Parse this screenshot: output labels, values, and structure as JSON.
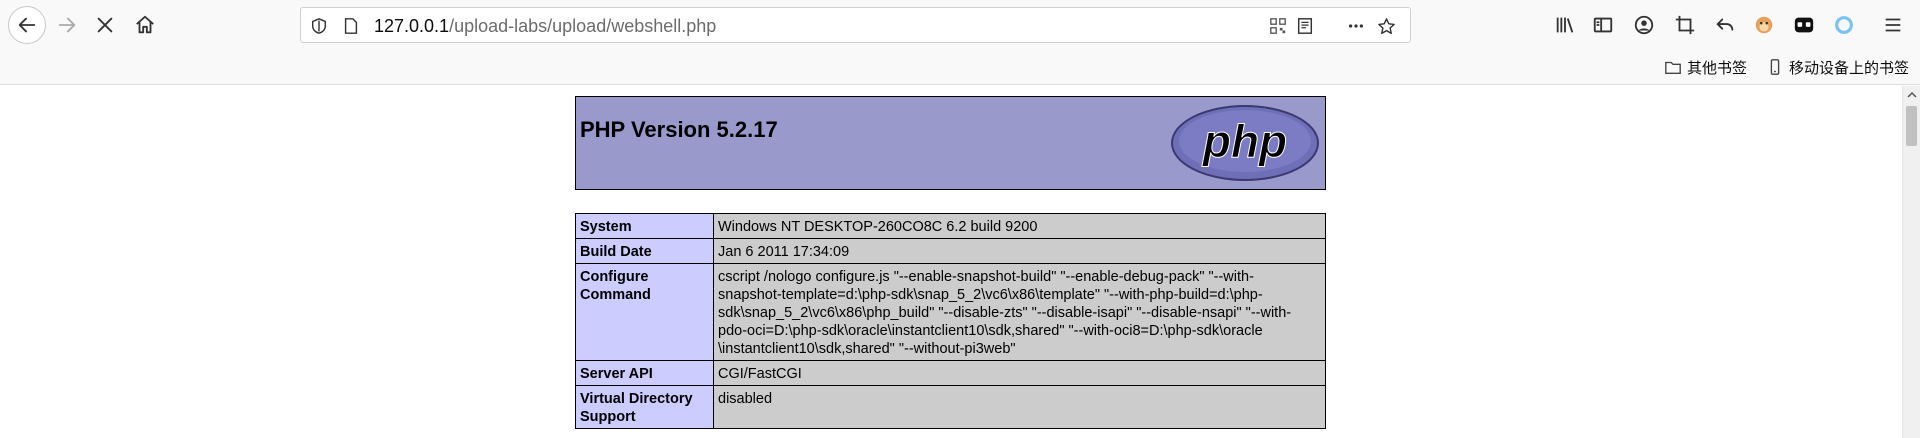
{
  "browser": {
    "url_host": "127.0.0.1",
    "url_path": "/upload-labs/upload/webshell.php",
    "bookmarks": [
      {
        "label": "其他书签",
        "icon": "folder-icon"
      },
      {
        "label": "移动设备上的书签",
        "icon": "mobile-device-icon"
      }
    ]
  },
  "php": {
    "version_title": "PHP Version 5.2.17",
    "logo_text": "php",
    "rows": [
      {
        "key": "System",
        "value": "Windows NT DESKTOP-260CO8C 6.2 build 9200"
      },
      {
        "key": "Build Date",
        "value": "Jan 6 2011 17:34:09"
      },
      {
        "key_lines": [
          "Configure",
          "Command"
        ],
        "value_lines": [
          "cscript /nologo configure.js \"--enable-snapshot-build\" \"--enable-debug-pack\" \"--with-",
          "snapshot-template=d:\\php-sdk\\snap_5_2\\vc6\\x86\\template\" \"--with-php-build=d:\\php-",
          "sdk\\snap_5_2\\vc6\\x86\\php_build\" \"--disable-zts\" \"--disable-isapi\" \"--disable-nsapi\" \"--with-",
          "pdo-oci=D:\\php-sdk\\oracle\\instantclient10\\sdk,shared\" \"--with-oci8=D:\\php-sdk\\oracle",
          "\\instantclient10\\sdk,shared\" \"--without-pi3web\""
        ]
      },
      {
        "key": "Server API",
        "value": "CGI/FastCGI"
      },
      {
        "key_lines": [
          "Virtual Directory",
          "Support"
        ],
        "value": "disabled"
      }
    ]
  },
  "colors": {
    "php_header": "#9999cc",
    "key_cell": "#ccccff",
    "value_cell": "#cccccc"
  }
}
